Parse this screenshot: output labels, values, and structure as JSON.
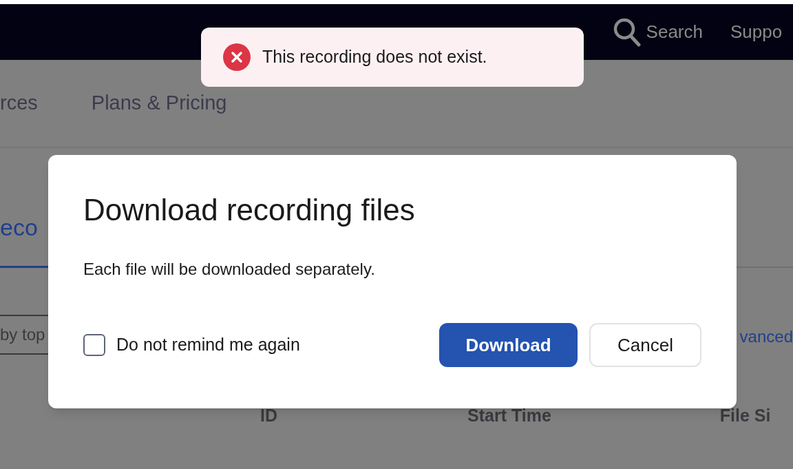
{
  "top_nav": {
    "search": {
      "label": "Search"
    },
    "links": [
      "Suppo"
    ]
  },
  "sub_nav": {
    "links": [
      "rces",
      "Plans & Pricing"
    ]
  },
  "tabs": [
    {
      "label": "eco",
      "selected": true
    }
  ],
  "filter": {
    "placeholder": "by top"
  },
  "advanced_link": "vanced",
  "table": {
    "columns": [
      "ID",
      "Start Time",
      "File Si"
    ]
  },
  "toast": {
    "kind": "error",
    "message": "This recording does not exist."
  },
  "dialog": {
    "title": "Download recording files",
    "message": "Each file will be downloaded separately.",
    "checkbox": {
      "label": "Do not remind me again",
      "checked": false
    },
    "buttons": [
      {
        "label": "Download",
        "kind": "primary"
      },
      {
        "label": "Cancel",
        "kind": "secondary"
      }
    ]
  }
}
